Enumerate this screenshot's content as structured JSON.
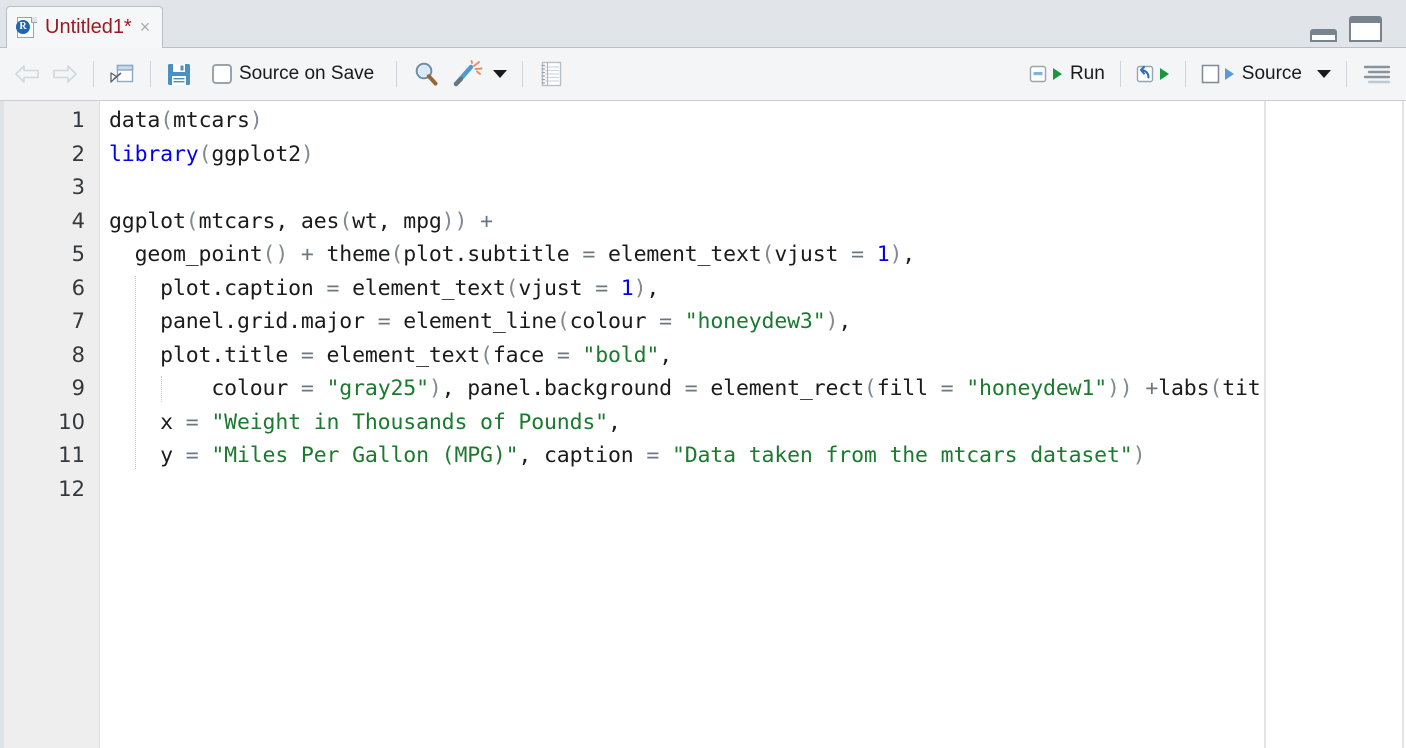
{
  "window": {
    "minimize_label": "minimize",
    "maximize_label": "maximize"
  },
  "tab": {
    "title": "Untitled1*",
    "close": "×",
    "icon_letter": "R"
  },
  "toolbar": {
    "back_label": "Back",
    "forward_label": "Forward",
    "popout_label": "Show in new window",
    "save_label": "Save current document",
    "source_on_save_label": "Source on Save",
    "find_label": "Find/Replace",
    "magic_label": "Code Tools",
    "compile_label": "Compile Report",
    "run_label": "Run",
    "rerun_label": "Re-run previous code region",
    "source_label": "Source",
    "outline_label": "Show document outline"
  },
  "editor": {
    "line_numbers": [
      "1",
      "2",
      "3",
      "4",
      "5",
      "6",
      "7",
      "8",
      "9",
      "10",
      "11",
      "12"
    ],
    "lines": [
      [
        {
          "t": "data",
          "c": "s-txt"
        },
        {
          "t": "(",
          "c": "s-par"
        },
        {
          "t": "mtcars",
          "c": "s-txt"
        },
        {
          "t": ")",
          "c": "s-par"
        }
      ],
      [
        {
          "t": "library",
          "c": "s-kw"
        },
        {
          "t": "(",
          "c": "s-par"
        },
        {
          "t": "ggplot2",
          "c": "s-txt"
        },
        {
          "t": ")",
          "c": "s-par"
        }
      ],
      [],
      [
        {
          "t": "ggplot",
          "c": "s-txt"
        },
        {
          "t": "(",
          "c": "s-par"
        },
        {
          "t": "mtcars, ",
          "c": "s-txt"
        },
        {
          "t": "aes",
          "c": "s-txt"
        },
        {
          "t": "(",
          "c": "s-par"
        },
        {
          "t": "wt, mpg",
          "c": "s-txt"
        },
        {
          "t": "))",
          "c": "s-par"
        },
        {
          "t": " ",
          "c": "s-txt"
        },
        {
          "t": "+",
          "c": "s-op"
        }
      ],
      [
        {
          "t": "  geom_point",
          "c": "s-txt"
        },
        {
          "t": "()",
          "c": "s-par"
        },
        {
          "t": " ",
          "c": "s-txt"
        },
        {
          "t": "+",
          "c": "s-op"
        },
        {
          "t": " theme",
          "c": "s-txt"
        },
        {
          "t": "(",
          "c": "s-par"
        },
        {
          "t": "plot.subtitle ",
          "c": "s-txt"
        },
        {
          "t": "=",
          "c": "s-op"
        },
        {
          "t": " element_text",
          "c": "s-txt"
        },
        {
          "t": "(",
          "c": "s-par"
        },
        {
          "t": "vjust ",
          "c": "s-txt"
        },
        {
          "t": "=",
          "c": "s-op"
        },
        {
          "t": " ",
          "c": "s-txt"
        },
        {
          "t": "1",
          "c": "s-num"
        },
        {
          "t": ")",
          "c": "s-par"
        },
        {
          "t": ",",
          "c": "s-txt"
        }
      ],
      [
        {
          "t": "    plot.caption ",
          "c": "s-txt"
        },
        {
          "t": "=",
          "c": "s-op"
        },
        {
          "t": " element_text",
          "c": "s-txt"
        },
        {
          "t": "(",
          "c": "s-par"
        },
        {
          "t": "vjust ",
          "c": "s-txt"
        },
        {
          "t": "=",
          "c": "s-op"
        },
        {
          "t": " ",
          "c": "s-txt"
        },
        {
          "t": "1",
          "c": "s-num"
        },
        {
          "t": ")",
          "c": "s-par"
        },
        {
          "t": ",",
          "c": "s-txt"
        }
      ],
      [
        {
          "t": "    panel.grid.major ",
          "c": "s-txt"
        },
        {
          "t": "=",
          "c": "s-op"
        },
        {
          "t": " element_line",
          "c": "s-txt"
        },
        {
          "t": "(",
          "c": "s-par"
        },
        {
          "t": "colour ",
          "c": "s-txt"
        },
        {
          "t": "=",
          "c": "s-op"
        },
        {
          "t": " ",
          "c": "s-txt"
        },
        {
          "t": "\"honeydew3\"",
          "c": "s-str"
        },
        {
          "t": ")",
          "c": "s-par"
        },
        {
          "t": ",",
          "c": "s-txt"
        }
      ],
      [
        {
          "t": "    plot.title ",
          "c": "s-txt"
        },
        {
          "t": "=",
          "c": "s-op"
        },
        {
          "t": " element_text",
          "c": "s-txt"
        },
        {
          "t": "(",
          "c": "s-par"
        },
        {
          "t": "face ",
          "c": "s-txt"
        },
        {
          "t": "=",
          "c": "s-op"
        },
        {
          "t": " ",
          "c": "s-txt"
        },
        {
          "t": "\"bold\"",
          "c": "s-str"
        },
        {
          "t": ",",
          "c": "s-txt"
        }
      ],
      [
        {
          "t": "        colour ",
          "c": "s-txt"
        },
        {
          "t": "=",
          "c": "s-op"
        },
        {
          "t": " ",
          "c": "s-txt"
        },
        {
          "t": "\"gray25\"",
          "c": "s-str"
        },
        {
          "t": ")",
          "c": "s-par"
        },
        {
          "t": ", panel.background ",
          "c": "s-txt"
        },
        {
          "t": "=",
          "c": "s-op"
        },
        {
          "t": " element_rect",
          "c": "s-txt"
        },
        {
          "t": "(",
          "c": "s-par"
        },
        {
          "t": "fill ",
          "c": "s-txt"
        },
        {
          "t": "=",
          "c": "s-op"
        },
        {
          "t": " ",
          "c": "s-txt"
        },
        {
          "t": "\"honeydew1\"",
          "c": "s-str"
        },
        {
          "t": "))",
          "c": "s-par"
        },
        {
          "t": " ",
          "c": "s-txt"
        },
        {
          "t": "+",
          "c": "s-op"
        },
        {
          "t": "labs",
          "c": "s-txt"
        },
        {
          "t": "(",
          "c": "s-par"
        },
        {
          "t": "tit",
          "c": "s-txt"
        }
      ],
      [
        {
          "t": "    x ",
          "c": "s-txt"
        },
        {
          "t": "=",
          "c": "s-op"
        },
        {
          "t": " ",
          "c": "s-txt"
        },
        {
          "t": "\"Weight in Thousands of Pounds\"",
          "c": "s-str"
        },
        {
          "t": ",",
          "c": "s-txt"
        }
      ],
      [
        {
          "t": "    y ",
          "c": "s-txt"
        },
        {
          "t": "=",
          "c": "s-op"
        },
        {
          "t": " ",
          "c": "s-txt"
        },
        {
          "t": "\"Miles Per Gallon (MPG)\"",
          "c": "s-str"
        },
        {
          "t": ", caption ",
          "c": "s-txt"
        },
        {
          "t": "=",
          "c": "s-op"
        },
        {
          "t": " ",
          "c": "s-txt"
        },
        {
          "t": "\"Data taken from the mtcars dataset\"",
          "c": "s-str"
        },
        {
          "t": ")",
          "c": "s-par"
        }
      ],
      []
    ],
    "full_source": "data(mtcars)\nlibrary(ggplot2)\n\nggplot(mtcars, aes(wt, mpg)) +\n  geom_point() + theme(plot.subtitle = element_text(vjust = 1),\n    plot.caption = element_text(vjust = 1),\n    panel.grid.major = element_line(colour = \"honeydew3\"),\n    plot.title = element_text(face = \"bold\",\n        colour = \"gray25\"), panel.background = element_rect(fill = \"honeydew1\")) +labs(title = \"Fuel Efficiency by Weight\",\n    x = \"Weight in Thousands of Pounds\",\n    y = \"Miles Per Gallon (MPG)\", caption = \"Data taken from the mtcars dataset\")\n"
  },
  "colors": {
    "keyword": "#0000ee",
    "string": "#1a7a2e",
    "number": "#0000ee",
    "paren": "#7f8a93",
    "operator": "#6b7780",
    "text": "#1b1b1b",
    "tab_title": "#9b1b20",
    "gutter_bg": "#eeeeee",
    "toolbar_bg": "#f3f5f6",
    "tabbar_bg": "#e1e5e9"
  }
}
